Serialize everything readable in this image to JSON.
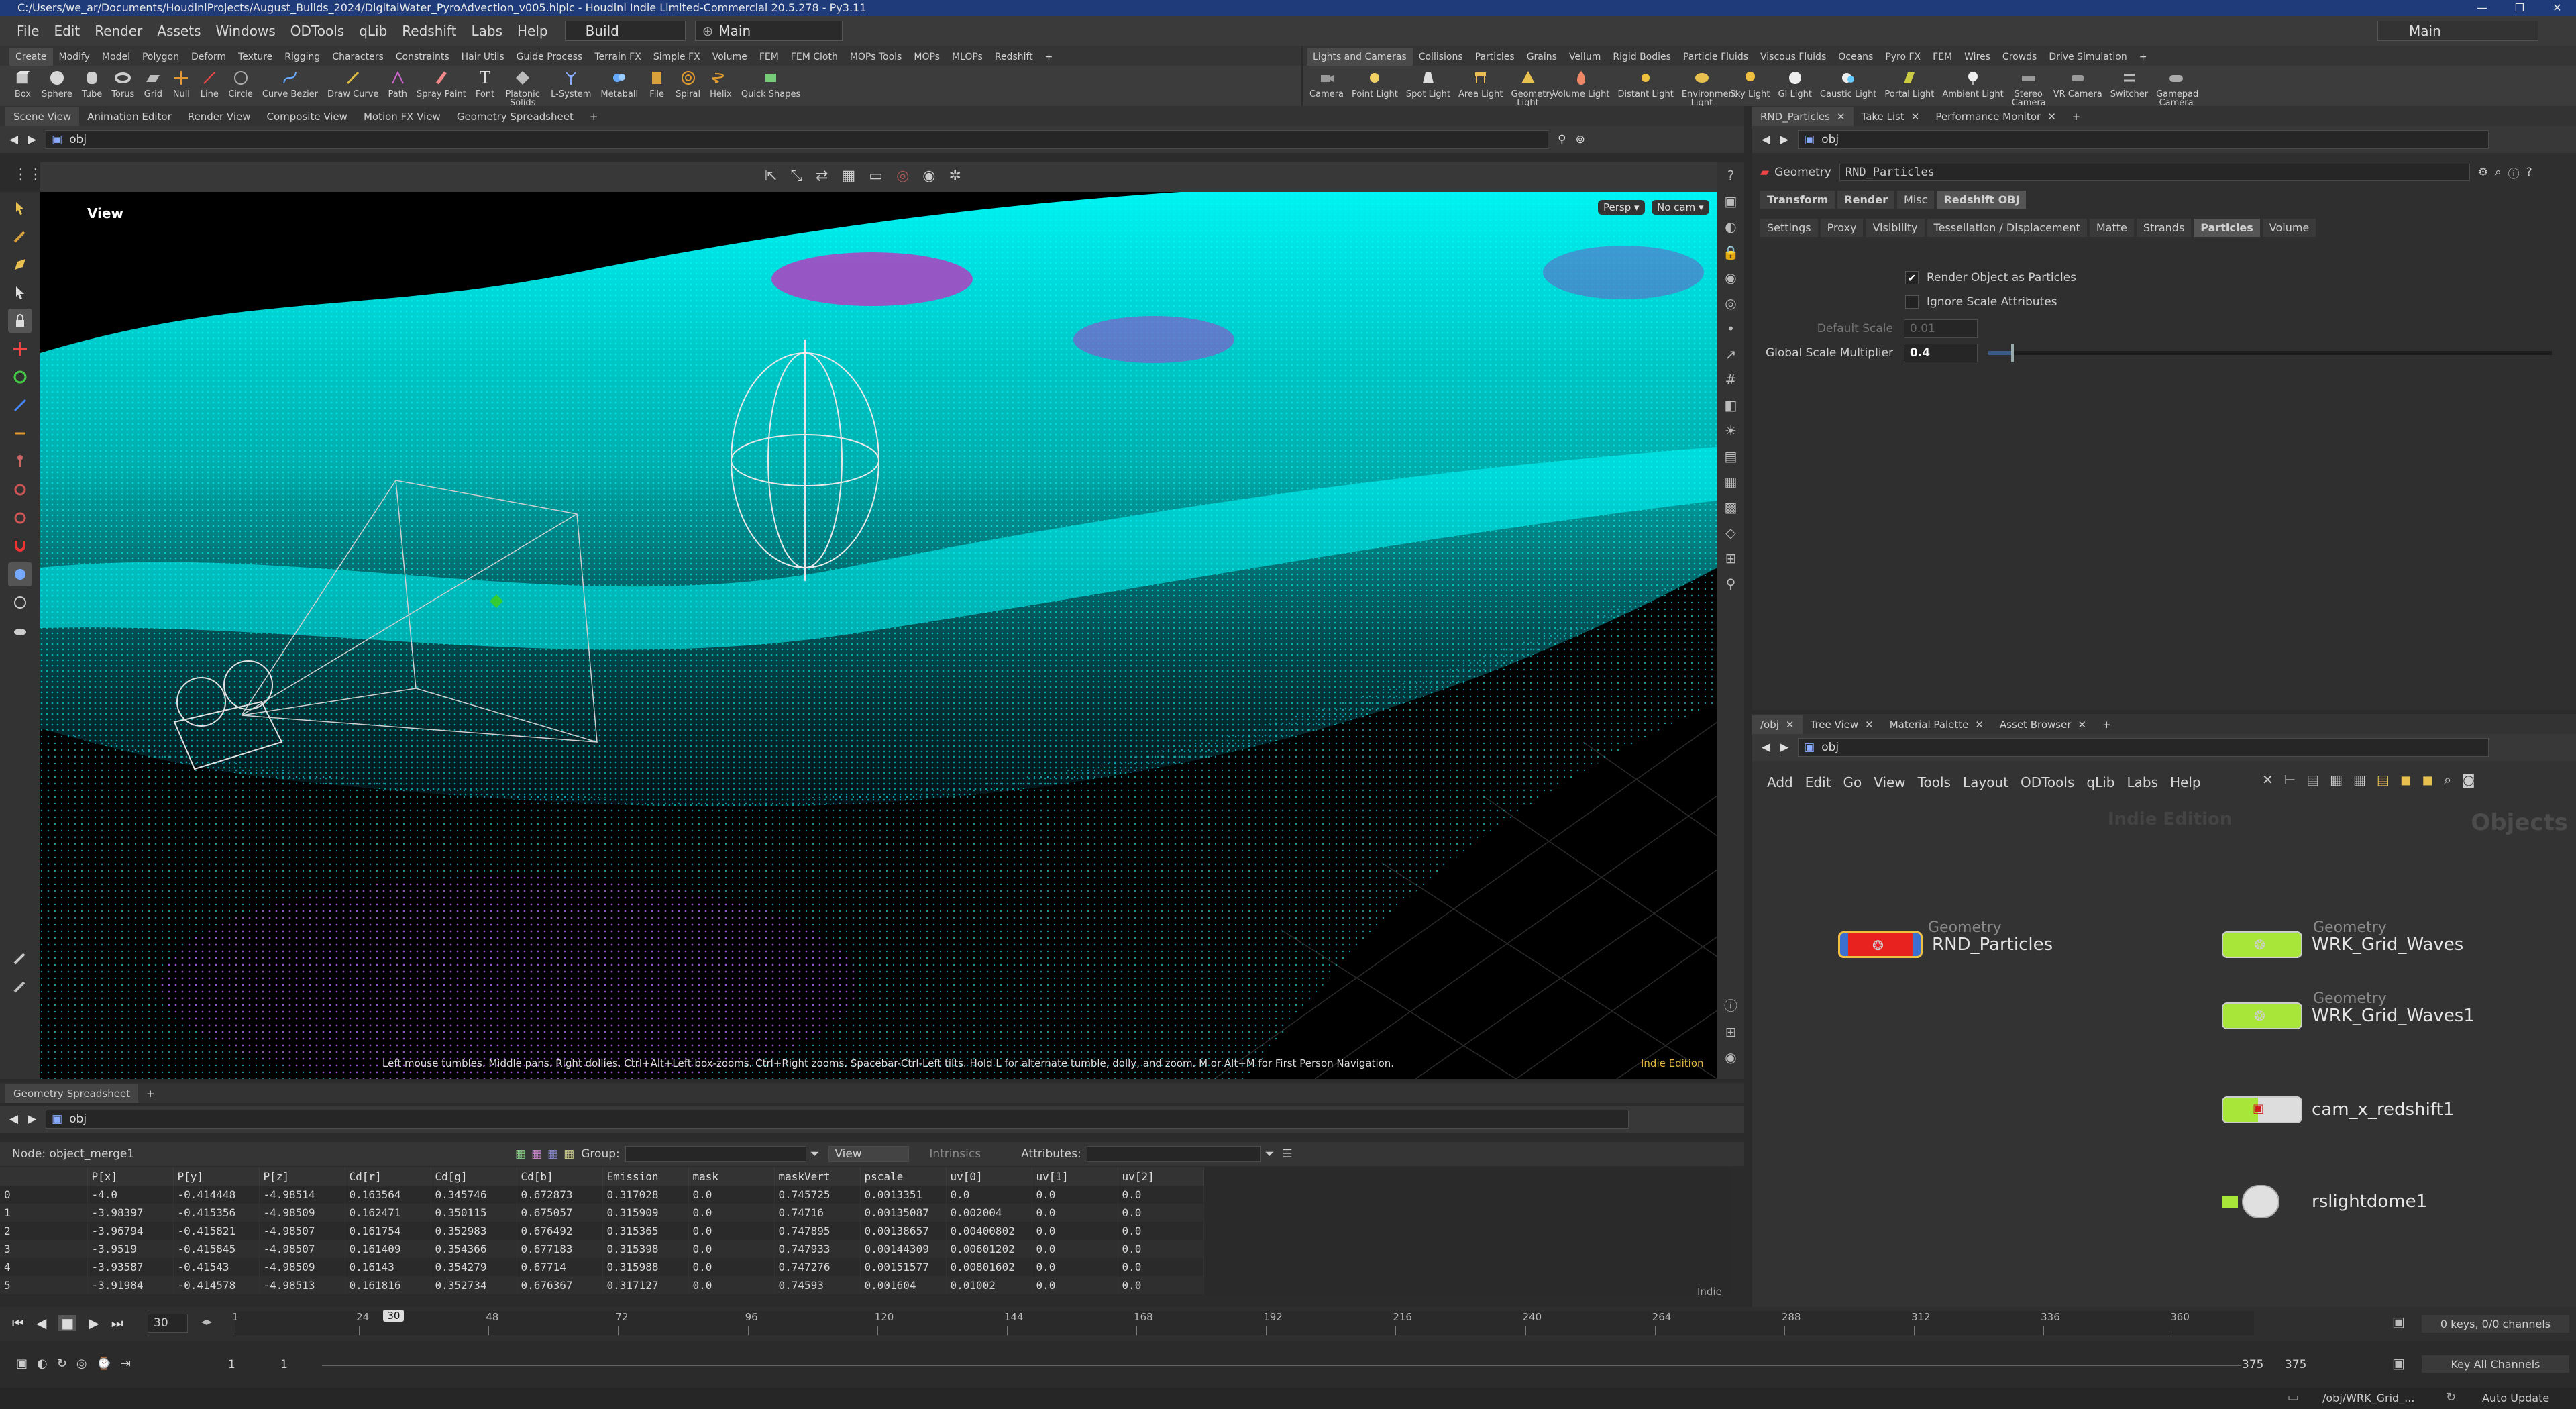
{
  "window": {
    "title": "C:/Users/we_ar/Documents/HoudiniProjects/August_Builds_2024/DigitalWater_PyroAdvection_v005.hiplc - Houdini Indie Limited-Commercial 20.5.278 - Py3.11",
    "controls": [
      "—",
      "❐",
      "✕"
    ]
  },
  "menu": {
    "items": [
      "File",
      "Edit",
      "Render",
      "Assets",
      "Windows",
      "ODTools",
      "qLib",
      "Redshift",
      "Labs",
      "Help"
    ],
    "build_label": "Build",
    "desktop_label": "Main",
    "desktop_right": "Main"
  },
  "shelf_left": {
    "tabs": [
      "Create",
      "Modify",
      "Model",
      "Polygon",
      "Deform",
      "Texture",
      "Rigging",
      "Characters",
      "Constraints",
      "Hair Utils",
      "Guide Process",
      "Terrain FX",
      "Simple FX",
      "Volume",
      "FEM",
      "FEM Cloth",
      "MOPs Tools",
      "MOPs",
      "MLOPs",
      "Redshift"
    ],
    "tools": [
      "Box",
      "Sphere",
      "Tube",
      "Torus",
      "Grid",
      "Null",
      "Line",
      "Circle",
      "Curve Bezier",
      "Draw Curve",
      "Path",
      "Spray Paint",
      "Font",
      "Platonic Solids",
      "L-System",
      "Metaball",
      "File",
      "Spiral",
      "Helix",
      "Quick Shapes"
    ]
  },
  "shelf_right": {
    "tabs": [
      "Lights and Cameras",
      "Collisions",
      "Particles",
      "Grains",
      "Vellum",
      "Rigid Bodies",
      "Particle Fluids",
      "Viscous Fluids",
      "Oceans",
      "Pyro FX",
      "FEM",
      "Wires",
      "Crowds",
      "Drive Simulation"
    ],
    "tools": [
      "Camera",
      "Point Light",
      "Spot Light",
      "Area Light",
      "Geometry Light",
      "Volume Light",
      "Distant Light",
      "Environment Light",
      "Sky Light",
      "GI Light",
      "Caustic Light",
      "Portal Light",
      "Ambient Light",
      "Stereo Camera",
      "VR Camera",
      "Switcher",
      "Gamepad Camera"
    ]
  },
  "left_panes": {
    "tabs": [
      "Scene View",
      "Animation Editor",
      "Render View",
      "Composite View",
      "Motion FX View",
      "Geometry Spreadsheet"
    ],
    "path": "obj"
  },
  "viewport": {
    "label": "View",
    "persp": "Persp ▾",
    "nocam": "No cam ▾",
    "hint": "Left mouse tumbles. Middle pans. Right dollies. Ctrl+Alt+Left box-zooms. Ctrl+Right zooms. Spacebar-Ctrl-Left tilts. Hold L for alternate tumble, dolly, and zoom.   M or Alt+M for First Person Navigation.",
    "edition": "Indie Edition"
  },
  "spreadsheet": {
    "tab": "Geometry Spreadsheet",
    "path": "obj",
    "node_label": "Node: object_merge1",
    "group_label": "Group:",
    "view_label": "View",
    "intrinsics_label": "Intrinsics",
    "attributes_label": "Attributes:",
    "indie": "Indie",
    "columns": [
      "",
      "P[x]",
      "P[y]",
      "P[z]",
      "Cd[r]",
      "Cd[g]",
      "Cd[b]",
      "Emission",
      "mask",
      "maskVert",
      "pscale",
      "uv[0]",
      "uv[1]",
      "uv[2]"
    ],
    "rows": [
      [
        "0",
        "-4.0",
        "-0.414448",
        "-4.98514",
        "0.163564",
        "0.345746",
        "0.672873",
        "0.317028",
        "0.0",
        "0.745725",
        "0.0013351",
        "0.0",
        "0.0",
        "0.0"
      ],
      [
        "1",
        "-3.98397",
        "-0.415356",
        "-4.98509",
        "0.162471",
        "0.350115",
        "0.675057",
        "0.315909",
        "0.0",
        "0.74716",
        "0.00135087",
        "0.002004",
        "0.0",
        "0.0"
      ],
      [
        "2",
        "-3.96794",
        "-0.415821",
        "-4.98507",
        "0.161754",
        "0.352983",
        "0.676492",
        "0.315365",
        "0.0",
        "0.747895",
        "0.00138657",
        "0.00400802",
        "0.0",
        "0.0"
      ],
      [
        "3",
        "-3.9519",
        "-0.415845",
        "-4.98507",
        "0.161409",
        "0.354366",
        "0.677183",
        "0.315398",
        "0.0",
        "0.747933",
        "0.00144309",
        "0.00601202",
        "0.0",
        "0.0"
      ],
      [
        "4",
        "-3.93587",
        "-0.41543",
        "-4.98509",
        "0.16143",
        "0.354279",
        "0.67714",
        "0.315988",
        "0.0",
        "0.747276",
        "0.00151577",
        "0.00801602",
        "0.0",
        "0.0"
      ],
      [
        "5",
        "-3.91984",
        "-0.414578",
        "-4.98513",
        "0.161816",
        "0.352734",
        "0.676367",
        "0.317127",
        "0.0",
        "0.74593",
        "0.001604",
        "0.01002",
        "0.0",
        "0.0"
      ]
    ]
  },
  "params": {
    "tabs": [
      "RND_Particles",
      "Take List",
      "Performance Monitor"
    ],
    "path": "obj",
    "type_label": "Geometry",
    "node_name": "RND_Particles",
    "main_tabs": [
      "Transform",
      "Render",
      "Misc",
      "Redshift OBJ"
    ],
    "sub_tabs": [
      "Settings",
      "Proxy",
      "Visibility",
      "Tessellation / Displacement",
      "Matte",
      "Strands",
      "Particles",
      "Volume"
    ],
    "render_as_particles": "Render Object as Particles",
    "ignore_scale_attr": "Ignore Scale Attributes",
    "default_scale_label": "Default Scale",
    "default_scale_value": "0.01",
    "global_scale_label": "Global Scale Multiplier",
    "global_scale_value": "0.4",
    "global_scale_fraction": 0.04
  },
  "network": {
    "tabs": [
      "/obj",
      "Tree View",
      "Material Palette",
      "Asset Browser"
    ],
    "path": "obj",
    "menu": [
      "Add",
      "Edit",
      "Go",
      "View",
      "Tools",
      "Layout",
      "ODTools",
      "qLib",
      "Labs",
      "Help"
    ],
    "watermark": "Indie Edition",
    "context": "Objects",
    "nodes": [
      {
        "type": "Geometry",
        "name": "RND_Particles",
        "color": "#e8231f"
      },
      {
        "type": "Geometry",
        "name": "WRK_Grid_Waves",
        "color": "#a8e63a"
      },
      {
        "type": "Geometry",
        "name": "WRK_Grid_Waves1",
        "color": "#a8e63a"
      },
      {
        "type": "",
        "name": "cam_x_redshift1",
        "color": "#a8e63a"
      },
      {
        "type": "",
        "name": "rslightdome1",
        "color": "#dddddd"
      }
    ]
  },
  "timeline": {
    "current_frame": "30",
    "frame_marker": "30",
    "ticks": [
      "1",
      "24",
      "48",
      "72",
      "96",
      "120",
      "144",
      "168",
      "192",
      "216",
      "240",
      "264",
      "288",
      "312",
      "336",
      "360"
    ],
    "range_start": "1",
    "range_start2": "1",
    "range_end": "375",
    "range_end2": "375",
    "keys": "0 keys, 0/0 channels",
    "key_all": "Key All Channels"
  },
  "status": {
    "path": "/obj/WRK_Grid_...",
    "auto_update": "Auto Update"
  }
}
